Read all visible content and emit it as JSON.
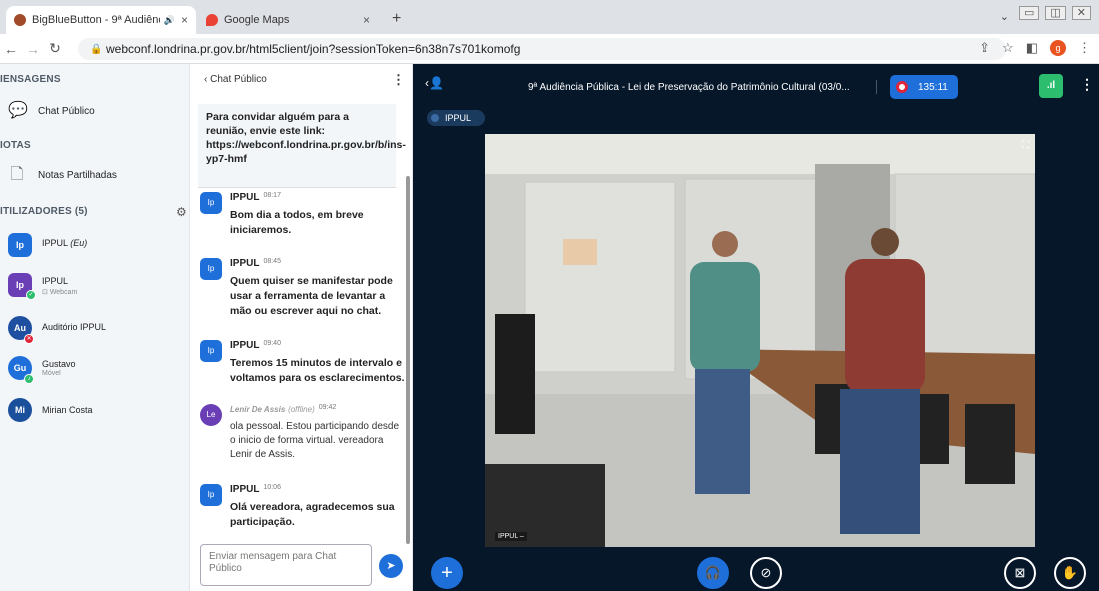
{
  "browser": {
    "tabs": [
      {
        "title": "BigBlueButton - 9ª Audiênci",
        "audio": "🔊",
        "close": "×",
        "active": true
      },
      {
        "title": "Google Maps",
        "close": "×",
        "active": false
      }
    ],
    "newtab": "+",
    "url": "webconf.londrina.pr.gov.br/html5client/join?sessionToken=6n38n7s701komofg",
    "profile_initial": "g"
  },
  "sidebar": {
    "messages_header": "IENSAGENS",
    "chat_item": "Chat Público",
    "notes_header": "IOTAS",
    "notes_item": "Notas Partilhadas",
    "users_header": "ITILIZADORES (5)",
    "users": [
      {
        "initials": "Ip",
        "name": "IPPUL",
        "suffix": "(Eu)",
        "sub": "",
        "color": "#1e6fd9",
        "shape": "square"
      },
      {
        "initials": "Ip",
        "name": "IPPUL",
        "suffix": "",
        "sub": "Webcam",
        "color": "#6a3fb5",
        "shape": "square"
      },
      {
        "initials": "Au",
        "name": "Auditório IPPUL",
        "suffix": "",
        "sub": "",
        "color": "#1e4fa0",
        "shape": "round"
      },
      {
        "initials": "Gu",
        "name": "Gustavo",
        "suffix": "",
        "sub": "Móvel",
        "color": "#1e6fd9",
        "shape": "round"
      },
      {
        "initials": "Mi",
        "name": "Mirian Costa",
        "suffix": "",
        "sub": "",
        "color": "#1a4f9c",
        "shape": "round"
      }
    ]
  },
  "chat": {
    "back_label": "‹  Chat Público",
    "invite": "Para convidar alguém para a reunião, envie este link: https://webconf.londrina.pr.gov.br/b/ins-yp7-hmf",
    "messages": [
      {
        "initials": "Ip",
        "author": "IPPUL",
        "status": "",
        "time": "08:17",
        "text": "Bom dia a todos, em breve iniciaremos."
      },
      {
        "initials": "Ip",
        "author": "IPPUL",
        "status": "",
        "time": "08:45",
        "text": "Quem quiser se manifestar pode usar a ferramenta de levantar a mão ou escrever aqui no chat."
      },
      {
        "initials": "Ip",
        "author": "IPPUL",
        "status": "",
        "time": "09:40",
        "text": "Teremos 15 minutos de intervalo e voltamos para os esclarecimentos."
      },
      {
        "initials": "Le",
        "author": "Lenir De Assis",
        "status": "(offline)",
        "time": "09:42",
        "text": "ola pessoal. Estou participando desde o inicio de forma virtual. vereadora Lenir de Assis."
      },
      {
        "initials": "Ip",
        "author": "IPPUL",
        "status": "",
        "time": "10:06",
        "text": "Olá vereadora, agradecemos sua participação."
      }
    ],
    "input_placeholder": "Enviar mensagem para Chat Público"
  },
  "meeting": {
    "title": "9ª Audiência Pública - Lei de Preservação do Patrimônio Cultural (03/0...",
    "timer": "135:11",
    "presenter_tag": "IPPUL",
    "video_label": "IPPUL –"
  },
  "colors": {
    "accent": "#1e6fd9",
    "dark": "#06172a",
    "record": "#e0243a",
    "connection": "#2dbd6e"
  }
}
